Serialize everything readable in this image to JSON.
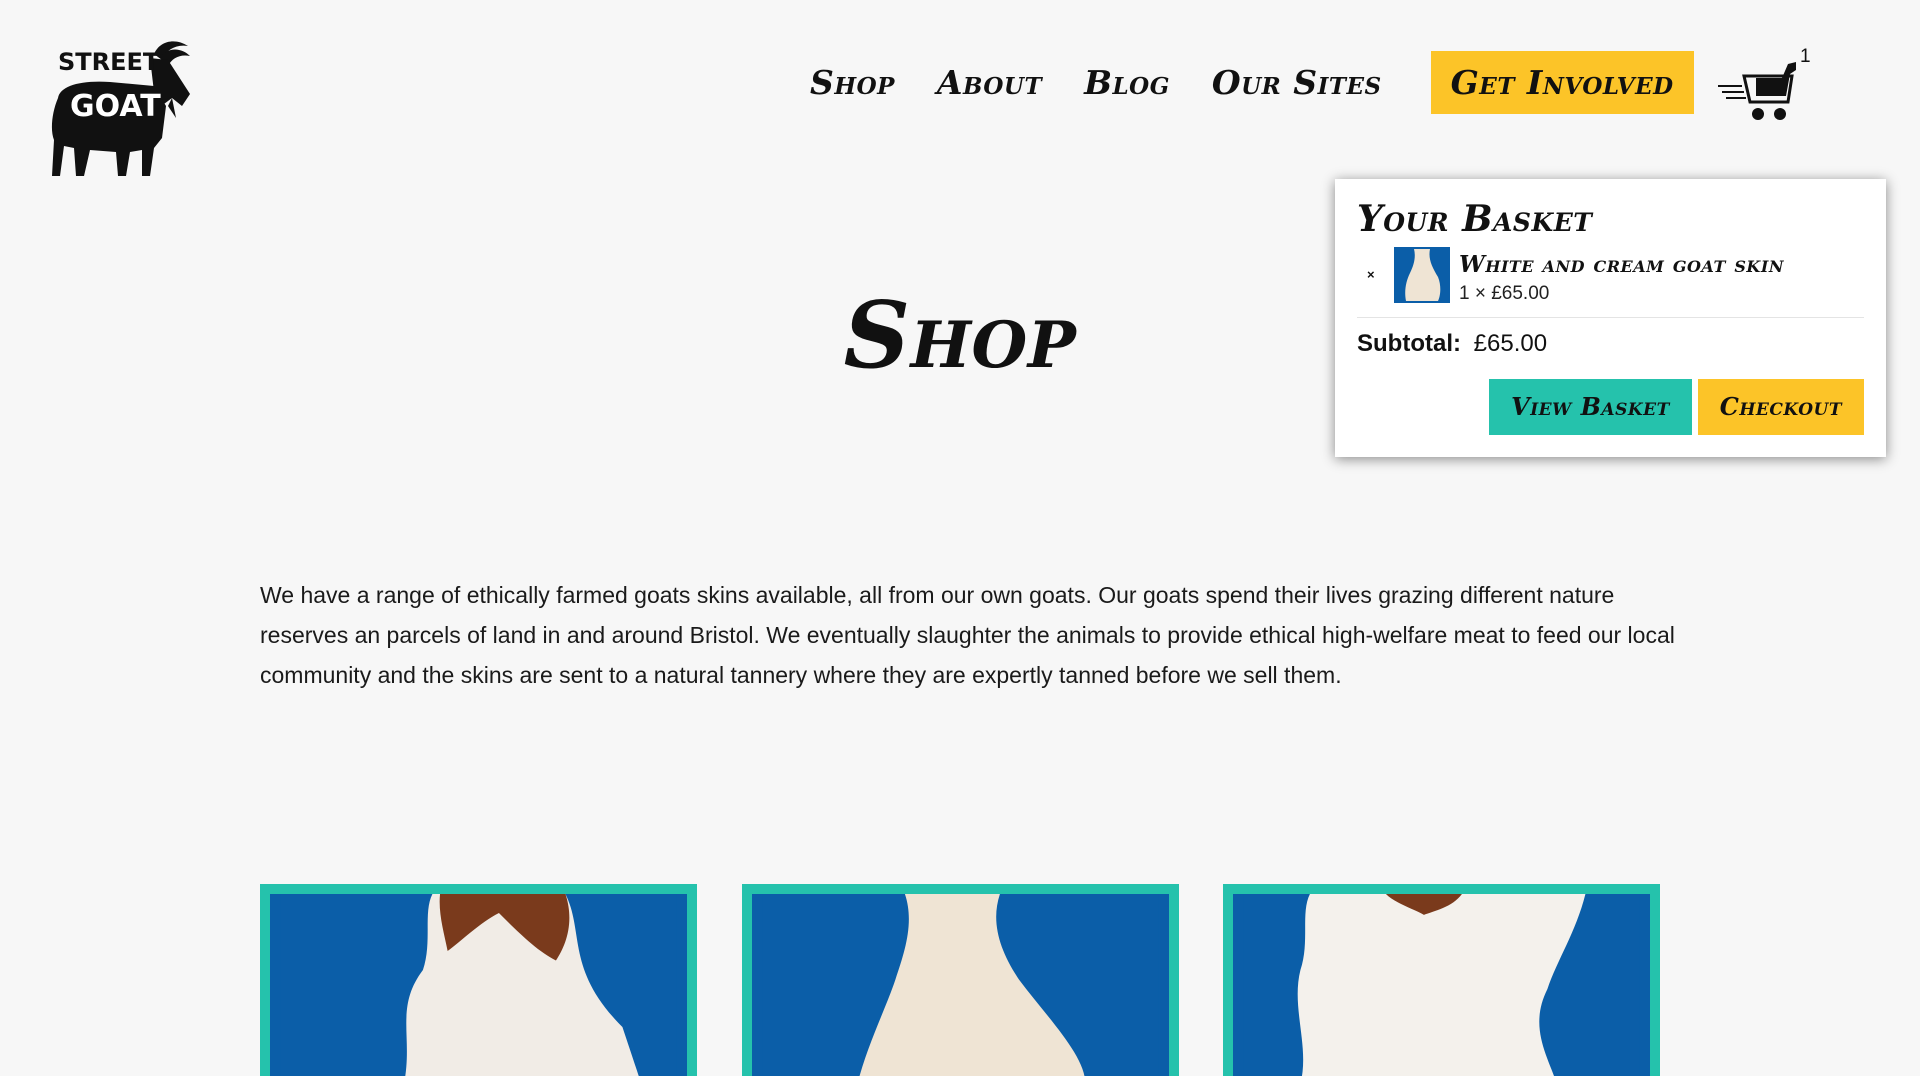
{
  "logo": {
    "alt": "Street Goat",
    "line1": "STREET",
    "line2": "GOAT"
  },
  "nav": {
    "links": [
      "Shop",
      "About",
      "Blog",
      "Our Sites"
    ],
    "cta": "Get Involved",
    "cart_count": "1"
  },
  "main": {
    "title": "Shop",
    "intro": "We have a range of ethically farmed goats skins available, all from our own goats. Our goats spend their lives grazing different nature reserves an parcels of land in and around Bristol. We eventually slaughter the animals to provide ethical high-welfare meat to feed our local community and the skins are sent to a natural tannery where they are expertly tanned before we sell them."
  },
  "basket": {
    "title": "Your Basket",
    "remove_label": "×",
    "item": {
      "name": "White and cream goat skin",
      "qty_price": "1 × £65.00"
    },
    "subtotal_label": "Subtotal:",
    "subtotal_value": "£65.00",
    "view_label": "View Basket",
    "checkout_label": "Checkout"
  },
  "colors": {
    "accent_teal": "#25c2ac",
    "accent_yellow": "#fcc428",
    "product_bg": "#0b5ea8",
    "page_bg": "#f7f7f7"
  },
  "products": [
    {
      "icon": "brown-white-goat-skin-image"
    },
    {
      "icon": "cream-goat-skin-image"
    },
    {
      "icon": "white-goat-skin-image"
    }
  ]
}
